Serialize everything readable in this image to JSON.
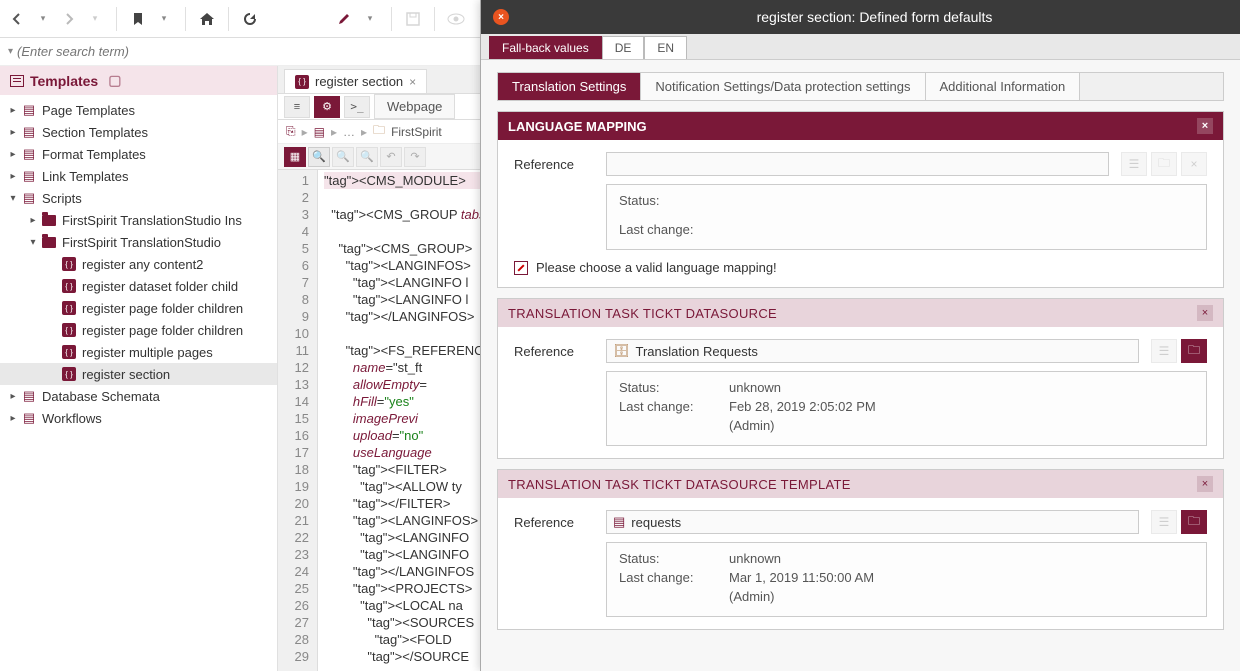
{
  "search": {
    "placeholder": "(Enter search term)"
  },
  "sidebar": {
    "title": "Templates",
    "items": [
      {
        "label": "Page Templates",
        "depth": 0,
        "type": "list",
        "toggle": "▸"
      },
      {
        "label": "Section Templates",
        "depth": 0,
        "type": "list",
        "toggle": "▸"
      },
      {
        "label": "Format Templates",
        "depth": 0,
        "type": "list",
        "toggle": "▸"
      },
      {
        "label": "Link Templates",
        "depth": 0,
        "type": "list",
        "toggle": "▸"
      },
      {
        "label": "Scripts",
        "depth": 0,
        "type": "list",
        "toggle": "▾"
      },
      {
        "label": "FirstSpirit TranslationStudio Ins",
        "depth": 1,
        "type": "folder",
        "toggle": "▸"
      },
      {
        "label": "FirstSpirit TranslationStudio",
        "depth": 1,
        "type": "folder",
        "toggle": "▾"
      },
      {
        "label": "register any content2",
        "depth": 2,
        "type": "script",
        "toggle": ""
      },
      {
        "label": "register dataset folder child",
        "depth": 2,
        "type": "script",
        "toggle": ""
      },
      {
        "label": "register page folder children",
        "depth": 2,
        "type": "script",
        "toggle": ""
      },
      {
        "label": "register page folder children",
        "depth": 2,
        "type": "script",
        "toggle": ""
      },
      {
        "label": "register multiple pages",
        "depth": 2,
        "type": "script",
        "toggle": ""
      },
      {
        "label": "register section",
        "depth": 2,
        "type": "script",
        "toggle": "",
        "selected": true
      },
      {
        "label": "Database Schemata",
        "depth": 0,
        "type": "list",
        "toggle": "▸"
      },
      {
        "label": "Workflows",
        "depth": 0,
        "type": "list",
        "toggle": "▸"
      }
    ]
  },
  "editor": {
    "tab_label": "register section",
    "subtab_webpage": "Webpage",
    "breadcrumb": "FirstSpirit",
    "code_lines": [
      "<CMS_MODULE>",
      "",
      "  <CMS_GROUP tabs=\"",
      "",
      "    <CMS_GROUP>",
      "      <LANGINFOS>",
      "        <LANGINFO l",
      "        <LANGINFO l",
      "      </LANGINFOS>",
      "",
      "      <FS_REFERENCE",
      "        name=\"st_ft",
      "        allowEmpty=",
      "        hFill=\"yes\"",
      "        imagePrevi",
      "        upload=\"no\"",
      "        useLanguage",
      "        <FILTER>",
      "          <ALLOW ty",
      "        </FILTER>",
      "        <LANGINFOS>",
      "          <LANGINFO",
      "          <LANGINFO",
      "        </LANGINFOS",
      "        <PROJECTS>",
      "          <LOCAL na",
      "            <SOURCES",
      "              <FOLD",
      "            </SOURCE"
    ]
  },
  "dialog": {
    "title": "register section: Defined form defaults",
    "lang_tabs": [
      "Fall-back values",
      "DE",
      "EN"
    ],
    "section_tabs": [
      "Translation Settings",
      "Notification Settings/Data protection settings",
      "Additional Information"
    ],
    "panels": {
      "lang_mapping": {
        "title": "LANGUAGE MAPPING",
        "ref_label": "Reference",
        "status_label": "Status:",
        "lastchange_label": "Last change:",
        "warning": "Please choose a valid language mapping!"
      },
      "task_ds": {
        "title": "TRANSLATION TASK TICKT DATASOURCE",
        "ref_label": "Reference",
        "ref_value": "Translation Requests",
        "status_label": "Status:",
        "status_value": "unknown",
        "lastchange_label": "Last change:",
        "lastchange_value": "Feb 28, 2019 2:05:02 PM",
        "lastchange_user": "(Admin)"
      },
      "task_tpl": {
        "title": "TRANSLATION TASK TICKT DATASOURCE TEMPLATE",
        "ref_label": "Reference",
        "ref_value": "requests",
        "status_label": "Status:",
        "status_value": "unknown",
        "lastchange_label": "Last change:",
        "lastchange_value": "Mar 1, 2019 11:50:00 AM",
        "lastchange_user": "(Admin)"
      }
    }
  }
}
